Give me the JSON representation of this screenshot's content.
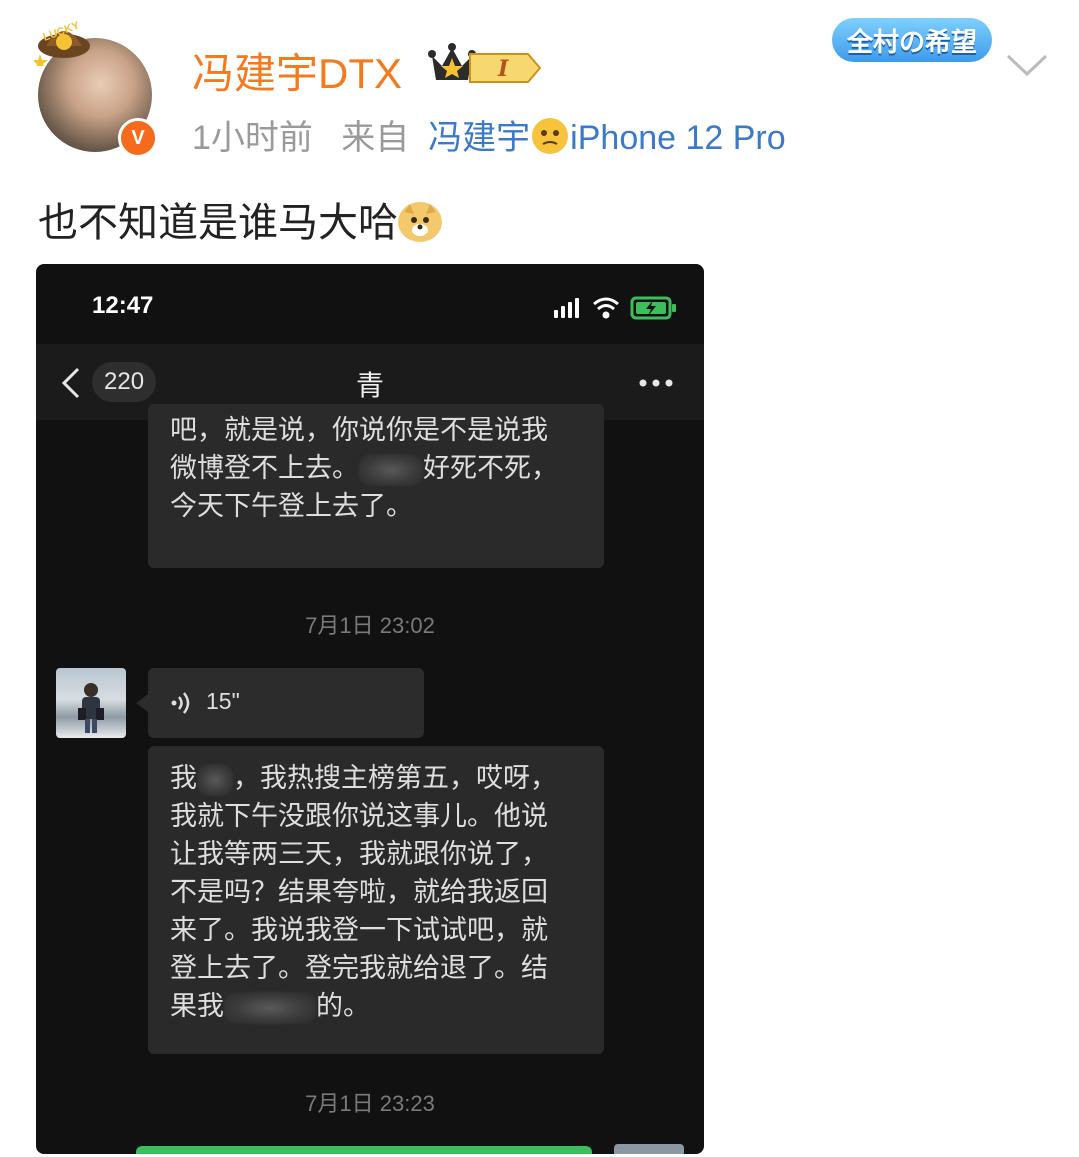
{
  "post": {
    "username": "冯建宇DTX",
    "level_badge": "I",
    "time": "1小时前",
    "from_label": "来自",
    "source_name": "冯建宇",
    "source_device": "iPhone 12 Pro",
    "lucky_badge": "LUCKY",
    "verified_badge": "V",
    "brand_tag": "全村の希望",
    "text": "也不知道是谁马大哈"
  },
  "screenshot": {
    "status_time": "12:47",
    "back_count": "220",
    "chat_title": "青",
    "message1_lines": [
      "吧，就是说，你说你是不是说我",
      "微博登不上去。",
      "好死不死，",
      "今天下午登上去了。"
    ],
    "timestamp1": "7月1日 23:02",
    "voice_duration": "15\"",
    "message2_lines": [
      "我",
      "，我热搜主榜第五，哎呀，",
      "我就下午没跟你说这事儿。他说",
      "让我等两三天，我就跟你说了，",
      "不是吗？结果夸啦，就给我返回",
      "来了。我说我登一下试试吧，就",
      "登上去了。登完我就给退了。结",
      "果我",
      "的。"
    ],
    "timestamp2": "7月1日 23:23"
  },
  "colors": {
    "username": "#f47a1f",
    "source_link": "#3b79c9",
    "verified": "#f56b1d",
    "chat_bg": "#111111",
    "bubble_bg": "#2a2a2a",
    "send_green": "#3dbd5c"
  }
}
